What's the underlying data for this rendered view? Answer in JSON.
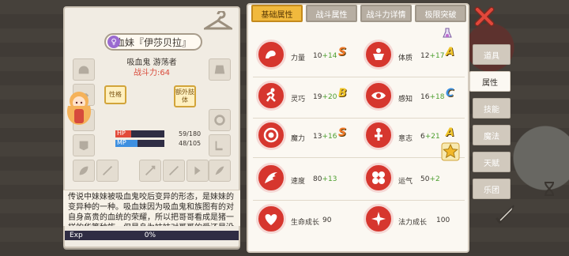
{
  "character": {
    "name": "血妹『伊莎贝拉』",
    "subtitle": "吸血鬼 游荡者",
    "power": "战斗力:64",
    "tags": {
      "personality": "性格",
      "extra_body": "额外肢体"
    },
    "hp": {
      "label": "HP",
      "current": 59,
      "max": 180,
      "text": "59/180",
      "color": "#e24a3a"
    },
    "mp": {
      "label": "MP",
      "current": 48,
      "max": 105,
      "text": "48/105",
      "color": "#3d8fe0"
    },
    "description": "传说中妹妹被吸血鬼咬后变异的形态，是妹妹的变异种的一种。吸血妹因为吸血鬼和族图有的对自身高贵的血统的荣耀，所以把哥哥看成是猪一样的华等种族，但是身为妹妹对哥哥的爱还是没",
    "exp": {
      "label": "Exp",
      "value": "0%"
    }
  },
  "tabs": [
    {
      "label": "基础属性",
      "active": true
    },
    {
      "label": "战斗属性",
      "active": false
    },
    {
      "label": "战斗力详情",
      "active": false
    },
    {
      "label": "极限突破",
      "active": false
    }
  ],
  "stats": [
    {
      "name": "力量",
      "base": "10",
      "bonus": "+14",
      "grade": "S",
      "grade_color": "#f07a2a",
      "icon": "arm-icon"
    },
    {
      "name": "体质",
      "base": "12",
      "bonus": "+17",
      "grade": "A",
      "grade_color": "#f0c52a",
      "icon": "body-icon"
    },
    {
      "name": "灵巧",
      "base": "19",
      "bonus": "+20",
      "grade": "B",
      "grade_color": "#f0c52a",
      "icon": "runner-icon"
    },
    {
      "name": "感知",
      "base": "16",
      "bonus": "+18",
      "grade": "C",
      "grade_color": "#3b8fe0",
      "icon": "eye-icon"
    },
    {
      "name": "魔力",
      "base": "13",
      "bonus": "+16",
      "grade": "S",
      "grade_color": "#f07a2a",
      "icon": "magic-orb-icon"
    },
    {
      "name": "意志",
      "base": "6",
      "bonus": "+21",
      "grade": "A",
      "grade_color": "#f0c52a",
      "icon": "will-icon"
    },
    {
      "name": "速度",
      "base": "80",
      "bonus": "+13",
      "grade": "",
      "grade_color": "",
      "icon": "wing-icon"
    },
    {
      "name": "运气",
      "base": "50",
      "bonus": "+2",
      "grade": "",
      "grade_color": "",
      "icon": "clover-icon"
    },
    {
      "name": "生命成长",
      "base": "90",
      "bonus": "",
      "grade": "",
      "grade_color": "",
      "icon": "heart-icon"
    },
    {
      "name": "法力成长",
      "base": "100",
      "bonus": "",
      "grade": "",
      "grade_color": "",
      "icon": "sparkle-icon"
    }
  ],
  "side_nav": [
    {
      "label": "道具",
      "active": false
    },
    {
      "label": "属性",
      "active": true
    },
    {
      "label": "技能",
      "active": false
    },
    {
      "label": "魔法",
      "active": false
    },
    {
      "label": "天赋",
      "active": false
    },
    {
      "label": "乐团",
      "active": false
    }
  ],
  "colors": {
    "accent": "#f1b93d",
    "stat_icon": "#d6362e",
    "power": "#d94b3c",
    "bonus": "#4c9e2f"
  }
}
